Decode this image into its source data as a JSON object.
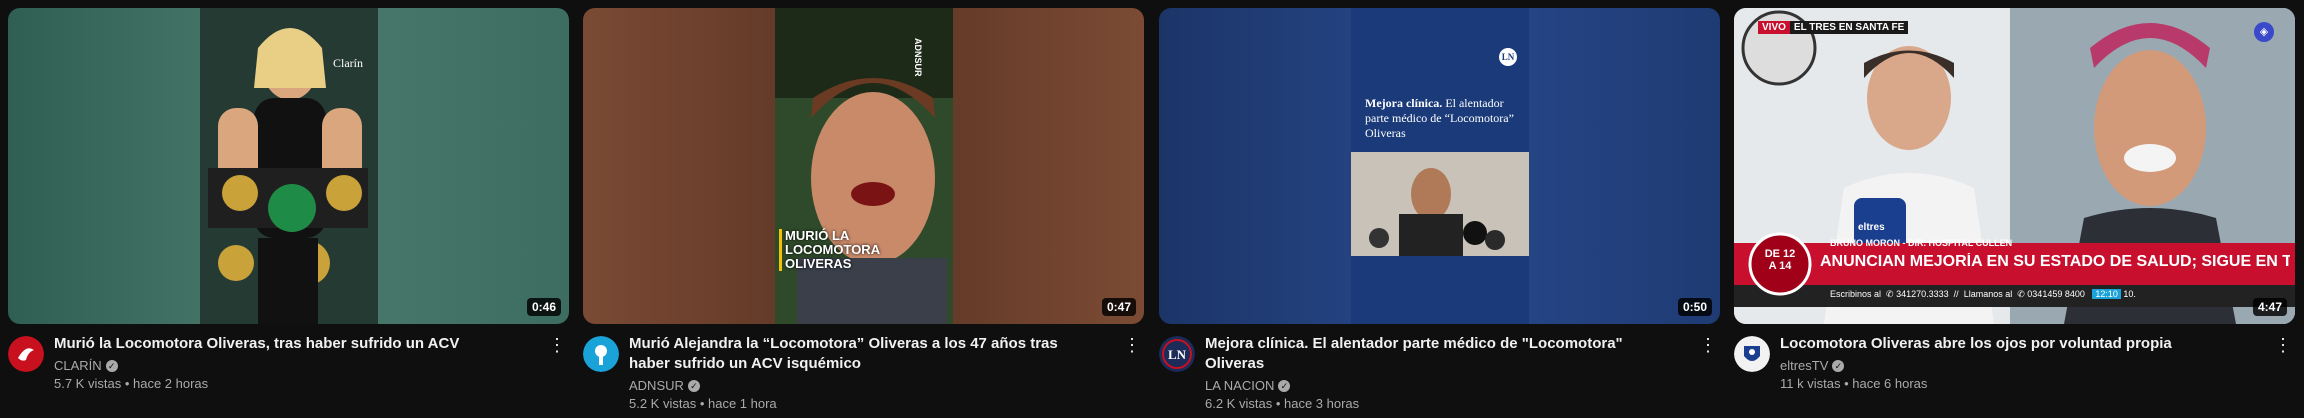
{
  "videos": [
    {
      "title": "Murió la Locomotora Oliveras, tras haber sufrido un ACV",
      "channel": "CLARÍN",
      "views": "5.7 K vistas",
      "age": "hace 2 horas",
      "duration": "0:46",
      "thumb_text": "Clarín",
      "avatar_icon": "clarin-logo-icon",
      "colors": {
        "bg": "#3a6b5c",
        "avatar": "#c9101f"
      }
    },
    {
      "title": "Murió Alejandra la “Locomotora” Oliveras a los 47 años tras haber sufrido un ACV isquémico",
      "channel": "ADNSUR",
      "views": "5.2 K vistas",
      "age": "hace 1 hora",
      "duration": "0:47",
      "thumb_text": "MURIÓ LA LOCOMOTORA OLIVERAS",
      "thumb_watermark": "ADNSUR",
      "avatar_icon": "adnsur-logo-icon",
      "colors": {
        "bg": "#6a3e2a",
        "avatar": "#1aa3d9"
      }
    },
    {
      "title": "Mejora clínica. El alentador parte médico de \"Locomotora\" Oliveras",
      "channel": "LA NACION",
      "views": "6.2 K vistas",
      "age": "hace 3 horas",
      "duration": "0:50",
      "thumb_heading": "Mejora clínica.",
      "thumb_body": "El alentador parte médico de “Locomotora” Oliveras",
      "thumb_logo": "LN",
      "avatar_icon": "la-nacion-logo-icon",
      "colors": {
        "bg": "#1d3a72",
        "avatar": "#1b2b5a"
      }
    },
    {
      "title": "Locomotora Oliveras abre los ojos por voluntad propia",
      "channel": "eltresTV",
      "views": "11 k vistas",
      "age": "hace 6 horas",
      "duration": "4:47",
      "live_tag": "VIVO",
      "live_label": "EL TRES EN SANTA FE",
      "lower_third_name": "BRUNO MORON - DIR. HOSPITAL CULLEN",
      "lower_third_headline": "ANUNCIAN MEJORÍA EN SU ESTADO DE SALUD; SIGUE EN TERAPIA",
      "date_badge_top": "DE 12",
      "date_badge_bottom": "A 14",
      "ticker_left": "Escribinos al",
      "ticker_phone": "341270.3333",
      "ticker_mid": "Llamanos al",
      "ticker_phone2": "0341459 8400",
      "ticker_time": "12:10",
      "ticker_end": "10.",
      "mic_text": "eltres",
      "avatar_icon": "eltres-logo-icon",
      "colors": {
        "bg": "#b8c2cc",
        "avatar": "#1b3f8f"
      }
    }
  ]
}
